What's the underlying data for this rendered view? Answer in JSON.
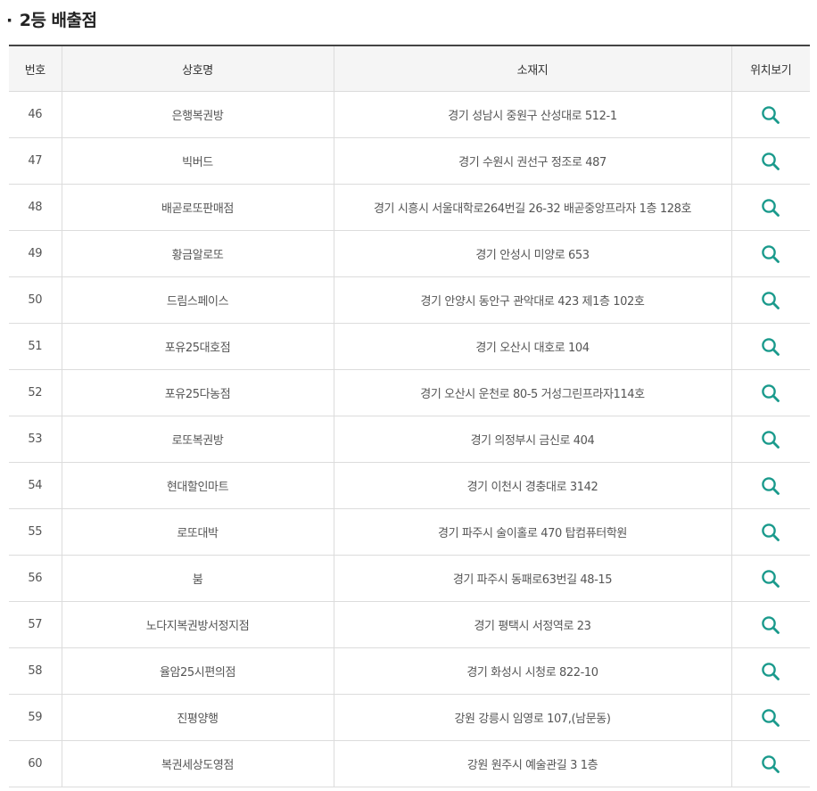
{
  "section": {
    "bullet": "·",
    "title": "2등 배출점"
  },
  "columns": {
    "no": "번호",
    "name": "상호명",
    "address": "소재지",
    "location": "위치보기"
  },
  "colors": {
    "search_icon": "#1a9a8c",
    "header_bg": "#f5f5f5",
    "top_border": "#444444"
  },
  "icons": {
    "location": "search-icon"
  },
  "rows": [
    {
      "no": "46",
      "name": "은행복권방",
      "address": "경기 성남시 중원구 산성대로 512-1"
    },
    {
      "no": "47",
      "name": "빅버드",
      "address": "경기 수원시 권선구 정조로 487"
    },
    {
      "no": "48",
      "name": "배곧로또판매점",
      "address": "경기 시흥시 서울대학로264번길 26-32 배곧중앙프라자 1층 128호"
    },
    {
      "no": "49",
      "name": "황금알로또",
      "address": "경기 안성시 미양로 653"
    },
    {
      "no": "50",
      "name": "드림스페이스",
      "address": "경기 안양시 동안구 관악대로 423 제1층 102호"
    },
    {
      "no": "51",
      "name": "포유25대호점",
      "address": "경기 오산시 대호로 104"
    },
    {
      "no": "52",
      "name": "포유25다농점",
      "address": "경기 오산시 운천로 80-5 거성그린프라자114호"
    },
    {
      "no": "53",
      "name": "로또복권방",
      "address": "경기 의정부시 금신로 404"
    },
    {
      "no": "54",
      "name": "현대할인마트",
      "address": "경기 이천시 경충대로 3142"
    },
    {
      "no": "55",
      "name": "로또대박",
      "address": "경기 파주시 술이홀로 470 탑컴퓨터학원"
    },
    {
      "no": "56",
      "name": "붐",
      "address": "경기 파주시 동패로63번길 48-15"
    },
    {
      "no": "57",
      "name": "노다지복권방서정지점",
      "address": "경기 평택시 서정역로 23"
    },
    {
      "no": "58",
      "name": "율암25시편의점",
      "address": "경기 화성시 시청로 822-10"
    },
    {
      "no": "59",
      "name": "진평양행",
      "address": "강원 강릉시 임영로 107,(남문동)"
    },
    {
      "no": "60",
      "name": "복권세상도영점",
      "address": "강원 원주시 예술관길 3 1층"
    }
  ]
}
